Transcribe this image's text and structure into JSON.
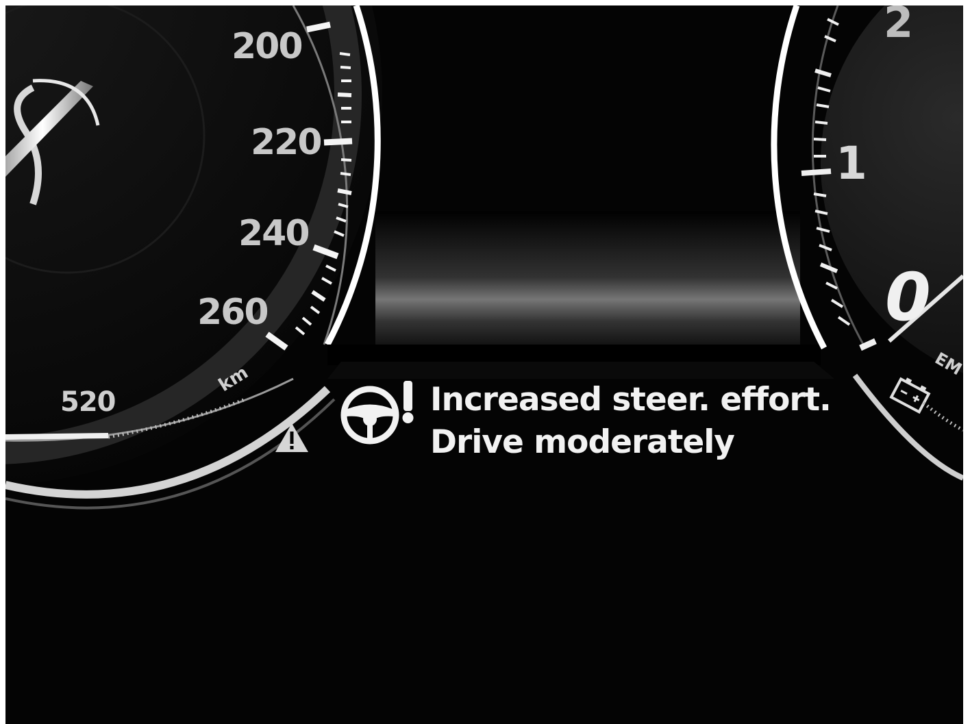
{
  "speedometer": {
    "tick_labels": [
      "200",
      "220",
      "240",
      "260"
    ],
    "range_value": "520",
    "range_unit": "km"
  },
  "tachometer": {
    "tick_labels": [
      "2",
      "1",
      "0"
    ]
  },
  "warning": {
    "line1": "Increased steer. effort.",
    "line2": "Drive moderately"
  },
  "colors": {
    "background": "#040404",
    "text": "#f2f2f2",
    "dial_text": "#c8c8c8"
  },
  "icons": [
    "steering-wheel-icon",
    "exclamation-icon",
    "warning-triangle-icon",
    "battery-icon"
  ]
}
